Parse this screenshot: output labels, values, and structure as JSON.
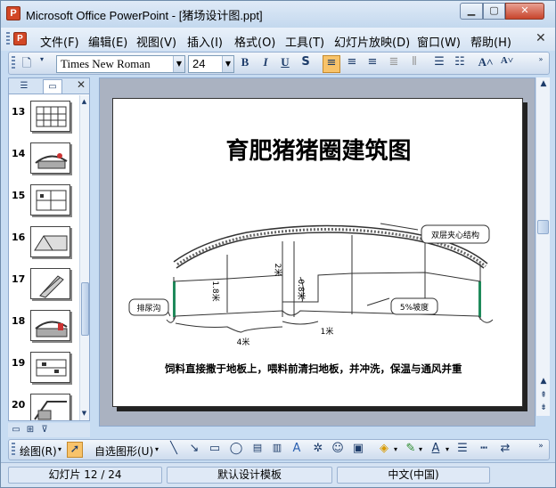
{
  "window": {
    "title": "Microsoft Office PowerPoint - [猪场设计图.ppt]",
    "app_icon": "P"
  },
  "menu": [
    "文件(F)",
    "编辑(E)",
    "视图(V)",
    "插入(I)",
    "格式(O)",
    "工具(T)",
    "幻灯片放映(D)",
    "窗口(W)",
    "帮助(H)"
  ],
  "toolbar": {
    "font_name": "Times New Roman",
    "font_size": "24"
  },
  "thumbnails": [
    "13",
    "14",
    "15",
    "16",
    "17",
    "18",
    "19",
    "20"
  ],
  "slide": {
    "title": "育肥猪猪圈建筑图",
    "labels": {
      "double_layer": "双层夹心结构",
      "drain": "排尿沟",
      "slope": "5%坡度",
      "h18": "1.8米",
      "h2": "2米",
      "h08": "0.8米",
      "w4": "4米",
      "w1": "1米"
    },
    "caption": "饲料直接撒于地板上，喂料前清扫地板，并冲洗，保温与通风并重"
  },
  "drawbar": {
    "draw": "绘图(R)",
    "autoshape": "自选图形(U)"
  },
  "status": {
    "slide": "幻灯片 12 / 24",
    "template": "默认设计模板",
    "language": "中文(中国)"
  },
  "colors": {
    "accent": "#d24726",
    "selection": "#f8c36a"
  }
}
